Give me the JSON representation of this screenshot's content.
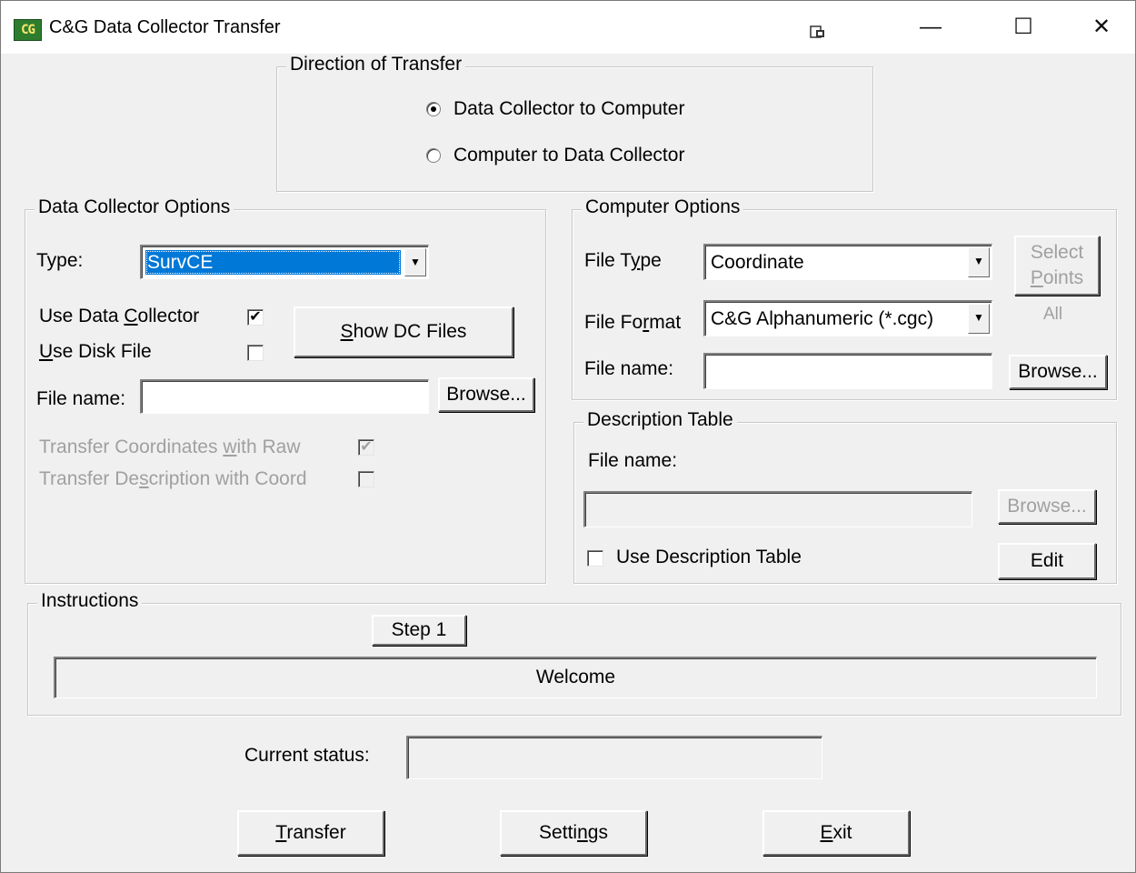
{
  "window": {
    "title": "C&G Data Collector Transfer",
    "icon": "cg-app-icon",
    "controls": {
      "minimize": "—",
      "maximize": "☐",
      "close": "✕"
    }
  },
  "direction": {
    "legend": "Direction of Transfer",
    "options": [
      {
        "label": "Data Collector to Computer",
        "selected": true
      },
      {
        "label": "Computer to Data Collector",
        "selected": false
      }
    ]
  },
  "dc_options": {
    "legend": "Data Collector Options",
    "type_label": "Type:",
    "type_value": "SurvCE",
    "use_dc_pre": "Use Data ",
    "use_dc_ul": "C",
    "use_dc_post": "ollector",
    "use_dc_checked": "✔",
    "use_disk_ul": "U",
    "use_disk_post": "se Disk File",
    "show_dc_ul": "S",
    "show_dc_post": "how DC Files",
    "file_name_label": "File name:",
    "file_name_value": "",
    "browse": "Browse...",
    "transfer_coords_pre": "Transfer Coordinates ",
    "transfer_coords_ul": "w",
    "transfer_coords_post": "ith Raw",
    "transfer_coords_checked": "✔",
    "transfer_desc_pre": "Transfer De",
    "transfer_desc_ul": "s",
    "transfer_desc_post": "cription with Coord"
  },
  "computer_options": {
    "legend": "Computer Options",
    "file_type_pre": "File T",
    "file_type_ul": "y",
    "file_type_post": "pe",
    "file_type_value": "Coordinate",
    "file_format_pre": "File Fo",
    "file_format_ul": "r",
    "file_format_post": "mat",
    "file_format_value": "C&G Alphanumeric (*.cgc)",
    "file_name_label": "File name:",
    "file_name_value": "",
    "browse": "Browse...",
    "select_line1": "Select",
    "select_ul": "P",
    "select_line2_post": "oints",
    "select_all": "All"
  },
  "description_table": {
    "legend": "Description Table",
    "file_name_label": "File name:",
    "file_name_value": "",
    "browse": "Browse...",
    "use_label": "Use Description Table",
    "edit": "Edit"
  },
  "instructions": {
    "legend": "Instructions",
    "step": "Step 1",
    "message": "Welcome"
  },
  "status": {
    "label": "Current status:",
    "value": ""
  },
  "footer": {
    "transfer_ul": "T",
    "transfer_post": "ransfer",
    "settings_pre": "Setti",
    "settings_ul": "n",
    "settings_post": "gs",
    "exit_ul": "E",
    "exit_post": "xit"
  },
  "colors": {
    "selection": "#0078d7",
    "window_bg": "#f0f0f0",
    "disabled_text": "#a0a0a0"
  }
}
